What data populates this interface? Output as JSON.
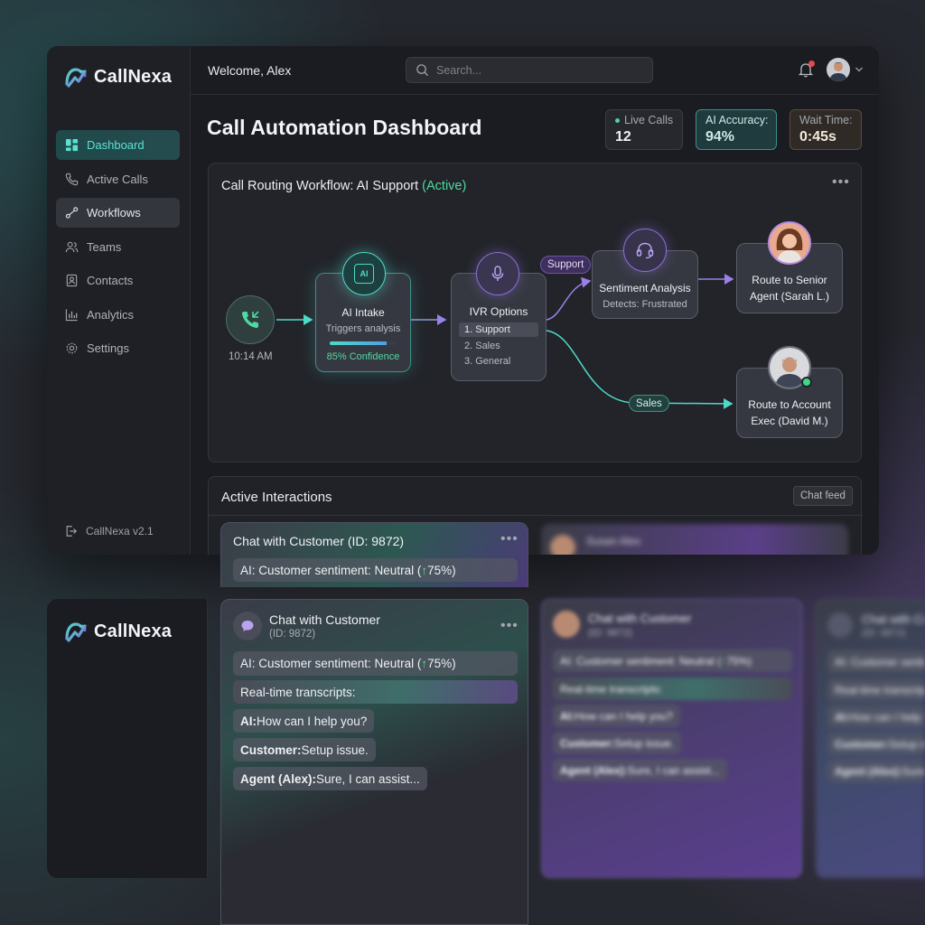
{
  "app": {
    "name": "CallNexa",
    "version": "CallNexa v2.1"
  },
  "sidebar": {
    "items": [
      {
        "label": "Dashboard",
        "icon": "dashboard-icon"
      },
      {
        "label": "Active Calls",
        "icon": "phone-icon"
      },
      {
        "label": "Workflows",
        "icon": "workflow-icon"
      },
      {
        "label": "Teams",
        "icon": "users-icon"
      },
      {
        "label": "Contacts",
        "icon": "contact-card-icon"
      },
      {
        "label": "Analytics",
        "icon": "bar-chart-icon"
      },
      {
        "label": "Settings",
        "icon": "gear-icon"
      }
    ]
  },
  "header": {
    "welcome": "Welcome, Alex",
    "search_placeholder": "Search..."
  },
  "page": {
    "title": "Call Automation Dashboard"
  },
  "stats": [
    {
      "label": "Live Calls",
      "value": "12"
    },
    {
      "label": "AI Accuracy:",
      "value": "94%"
    },
    {
      "label": "Wait Time:",
      "value": "0:45s"
    }
  ],
  "workflow": {
    "title": "Call Routing Workflow: AI Support",
    "status": "(Active)",
    "call_time": "10:14 AM",
    "ai_intake": {
      "icon_label": "AI",
      "title": "AI Intake",
      "sub": "Triggers analysis",
      "confidence": "85% Confidence",
      "progress": 0.85
    },
    "ivr": {
      "title": "IVR Options",
      "options": [
        "1. Support",
        "2. Sales",
        "3. General"
      ]
    },
    "support_label": "Support",
    "sales_label": "Sales",
    "sentiment": {
      "title": "Sentiment Analysis",
      "sub": "Detects: Frustrated"
    },
    "route_senior": {
      "line1": "Route to Senior",
      "line2": "Agent (Sarah L.)"
    },
    "route_account": {
      "line1": "Route to Account",
      "line2": "Exec (David M.)"
    }
  },
  "interactions": {
    "title": "Active Interactions",
    "feed_button": "Chat feed",
    "card_top": {
      "title": "Chat with Customer (ID: 9872)",
      "sentiment": "AI: Customer sentiment: Neutral (",
      "arrow": "↑",
      "pct": "75%)"
    },
    "blurred_name": "Susan Alex"
  },
  "chat_expanded": {
    "title": "Chat with Customer",
    "id": "(ID: 9872)",
    "sentiment": "AI: Customer sentiment: Neutral (",
    "arrow": "↑",
    "pct": "75%)",
    "transcripts_label": "Real-time transcripts:",
    "messages": [
      {
        "speaker": "AI:",
        "text": " How can I help you?"
      },
      {
        "speaker": "Customer:",
        "text": " Setup issue."
      },
      {
        "speaker": "Agent (Alex):",
        "text": " Sure, I can assist..."
      }
    ]
  },
  "colors": {
    "accent": "#4fd9c8",
    "active_green": "#4fd9a0",
    "purple": "#8d6fd6"
  }
}
